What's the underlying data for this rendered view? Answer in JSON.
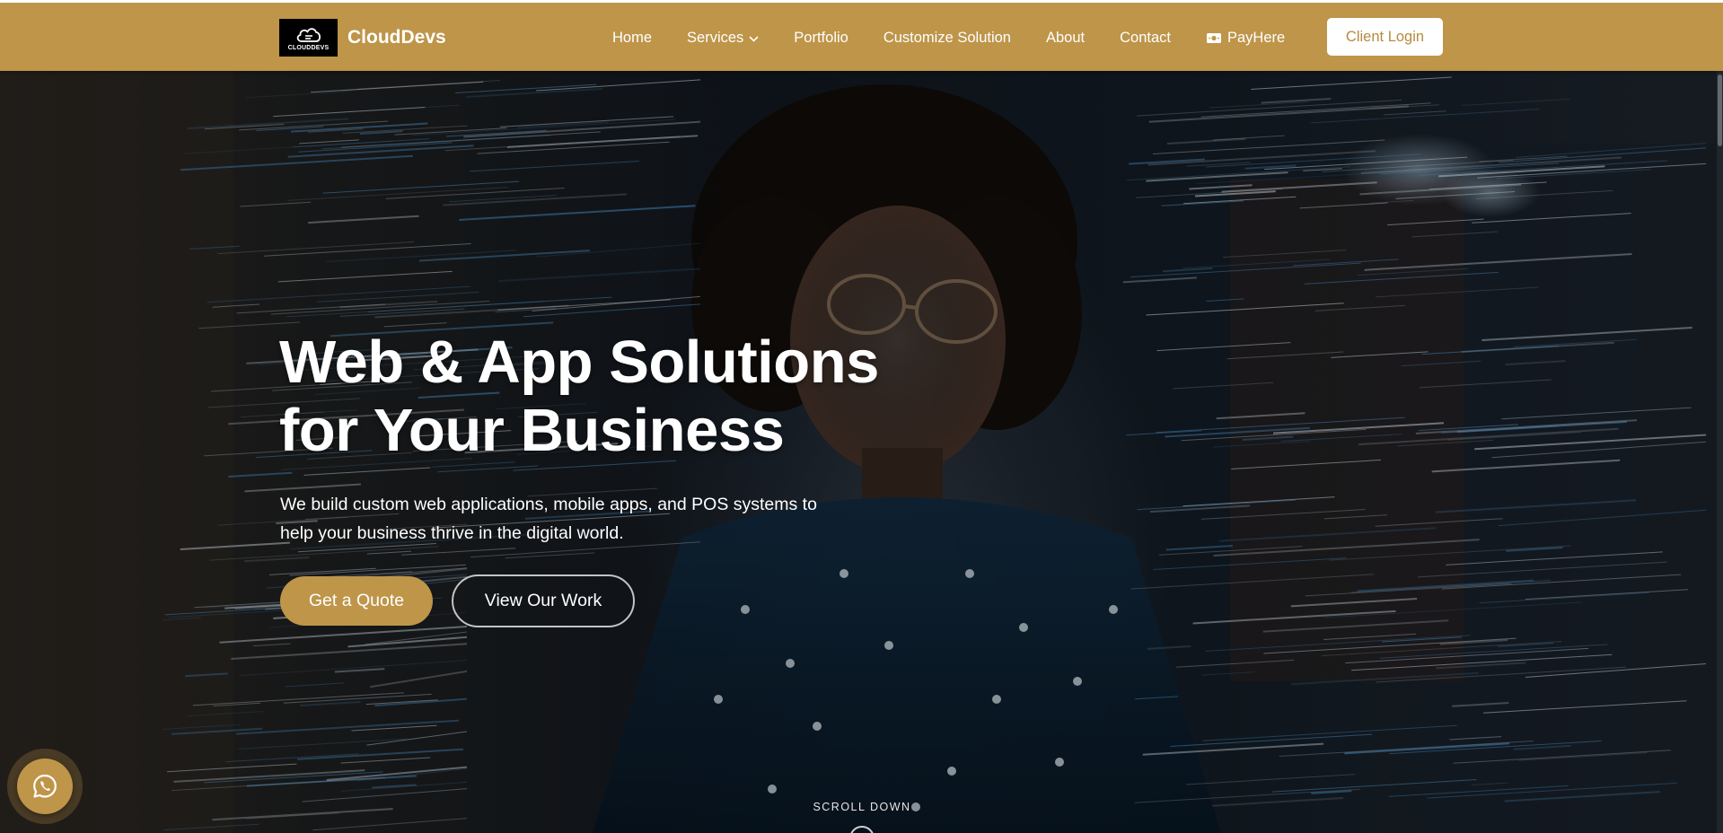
{
  "brand": {
    "name": "CloudDevs",
    "logo_text": "CLOUDDEVS"
  },
  "nav": {
    "items": [
      {
        "label": "Home"
      },
      {
        "label": "Services",
        "has_dropdown": true
      },
      {
        "label": "Portfolio"
      },
      {
        "label": "Customize Solution"
      },
      {
        "label": "About"
      },
      {
        "label": "Contact"
      },
      {
        "label": "PayHere",
        "icon": "money-icon"
      }
    ],
    "login_label": "Client Login"
  },
  "hero": {
    "title_line1": "Web & App Solutions",
    "title_line2": "for Your Business",
    "subtitle_line1": "We build custom web applications, mobile apps, and POS systems to",
    "subtitle_line2": "help your business thrive in the digital world.",
    "primary_cta": "Get a Quote",
    "secondary_cta": "View Our Work",
    "scroll_label": "SCROLL DOWN"
  },
  "floating": {
    "whatsapp_icon": "whatsapp-icon"
  },
  "colors": {
    "accent": "#be9549",
    "white": "#ffffff",
    "login_text": "#b58a3f",
    "hero_dark": "#0e141b",
    "data_streak": "#4a8fc7"
  }
}
